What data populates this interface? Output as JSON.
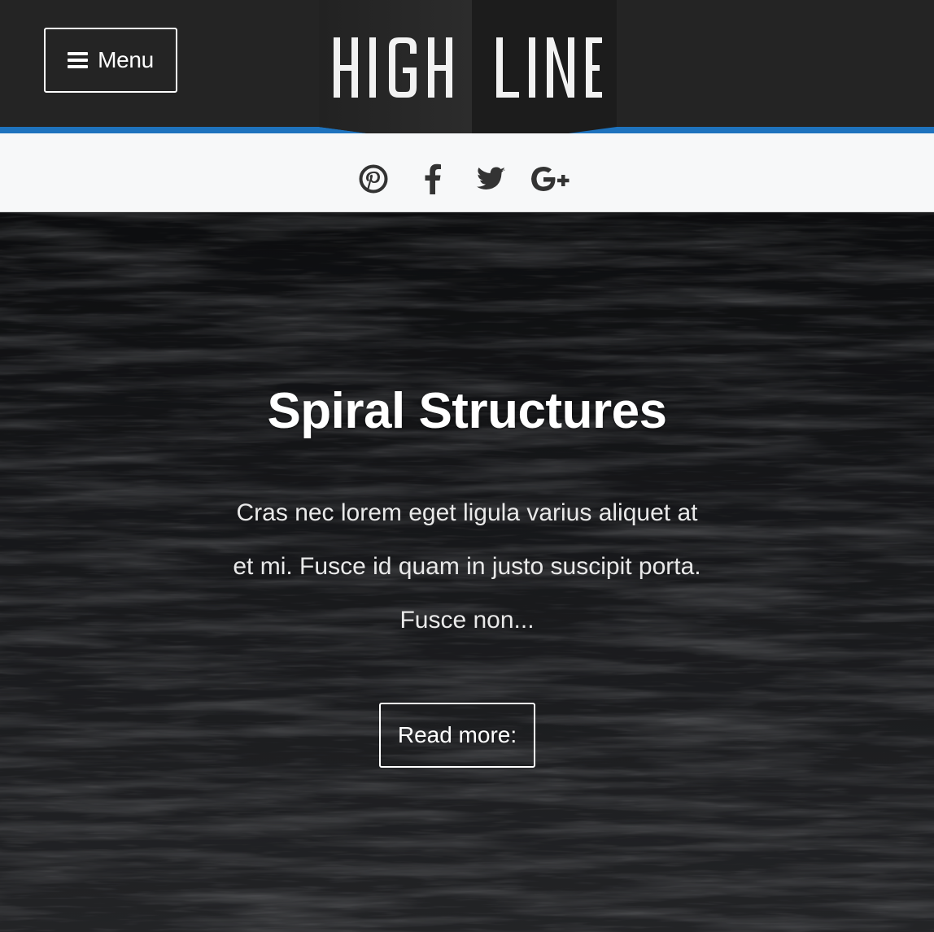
{
  "header": {
    "menu_label": "Menu",
    "logo_text": "HIGH LINE",
    "colors": {
      "header_bg": "#242424",
      "accent": "#1e73be"
    }
  },
  "social": {
    "icons": [
      "pinterest-icon",
      "facebook-icon",
      "twitter-icon",
      "google-plus-icon"
    ]
  },
  "hero": {
    "title": "Spiral Structures",
    "excerpt": "Cras nec lorem eget ligula varius aliquet at et mi. Fusce id quam in justo suscipit porta. Fusce non...",
    "read_more_label": "Read more:"
  }
}
